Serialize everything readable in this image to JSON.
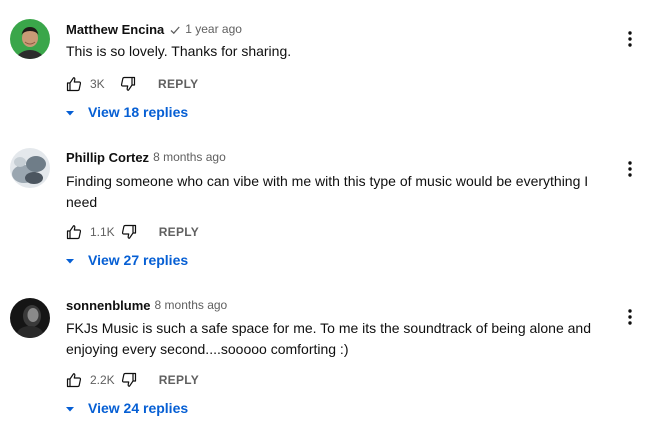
{
  "comments": [
    {
      "author": "Matthew Encina",
      "verified": true,
      "timestamp": "1 year ago",
      "text": "This is so lovely. Thanks for sharing.",
      "likes": "3K",
      "reply_label": "REPLY",
      "replies_label": "View 18 replies"
    },
    {
      "author": "Phillip Cortez",
      "verified": false,
      "timestamp": "8 months ago",
      "text": "Finding someone who can vibe with me with this type of music would be everything I need",
      "likes": "1.1K",
      "reply_label": "REPLY",
      "replies_label": "View 27 replies"
    },
    {
      "author": "sonnenblume",
      "verified": false,
      "timestamp": "8 months ago",
      "text": "FKJs Music is such a safe space for me.  To me its the soundtrack of being alone and enjoying every second....sooooo comforting :)",
      "likes": "2.2K",
      "reply_label": "REPLY",
      "replies_label": "View 24 replies"
    }
  ],
  "icons": {
    "like": "thumbs-up-icon",
    "dislike": "thumbs-down-icon",
    "menu": "more-vertical-icon",
    "expand": "caret-down-icon",
    "verified": "check-icon"
  },
  "colors": {
    "link": "#065fd4",
    "secondary_text": "#606060",
    "primary_text": "#0f0f0f"
  }
}
